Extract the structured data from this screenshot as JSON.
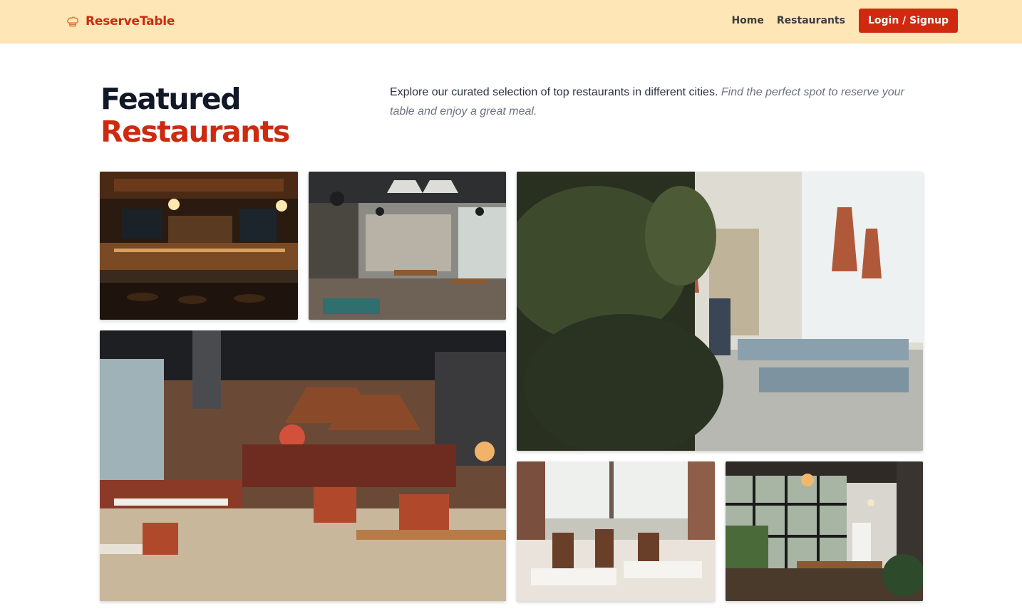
{
  "brand": {
    "name": "ReserveTable",
    "icon": "chef-hat-icon"
  },
  "nav": {
    "home_label": "Home",
    "restaurants_label": "Restaurants",
    "login_label": "Login / Signup"
  },
  "colors": {
    "accent": "#cc2b10",
    "navbar_bg": "#fee6b6",
    "heading_dark": "#111827"
  },
  "hero": {
    "title_line1": "Featured",
    "title_line2": "Restaurants",
    "intro_text": "Explore our curated selection of top restaurants in different cities.",
    "intro_italic": "Find the perfect spot to reserve your table and enjoy a great meal."
  },
  "gallery": {
    "photos": [
      {
        "name": "restaurant-photo-bar"
      },
      {
        "name": "restaurant-photo-industrial-cafe"
      },
      {
        "name": "restaurant-photo-plants-dining-room"
      },
      {
        "name": "restaurant-photo-large-dining-hall"
      },
      {
        "name": "restaurant-photo-window-tables"
      },
      {
        "name": "restaurant-photo-industrial-windows"
      }
    ]
  }
}
